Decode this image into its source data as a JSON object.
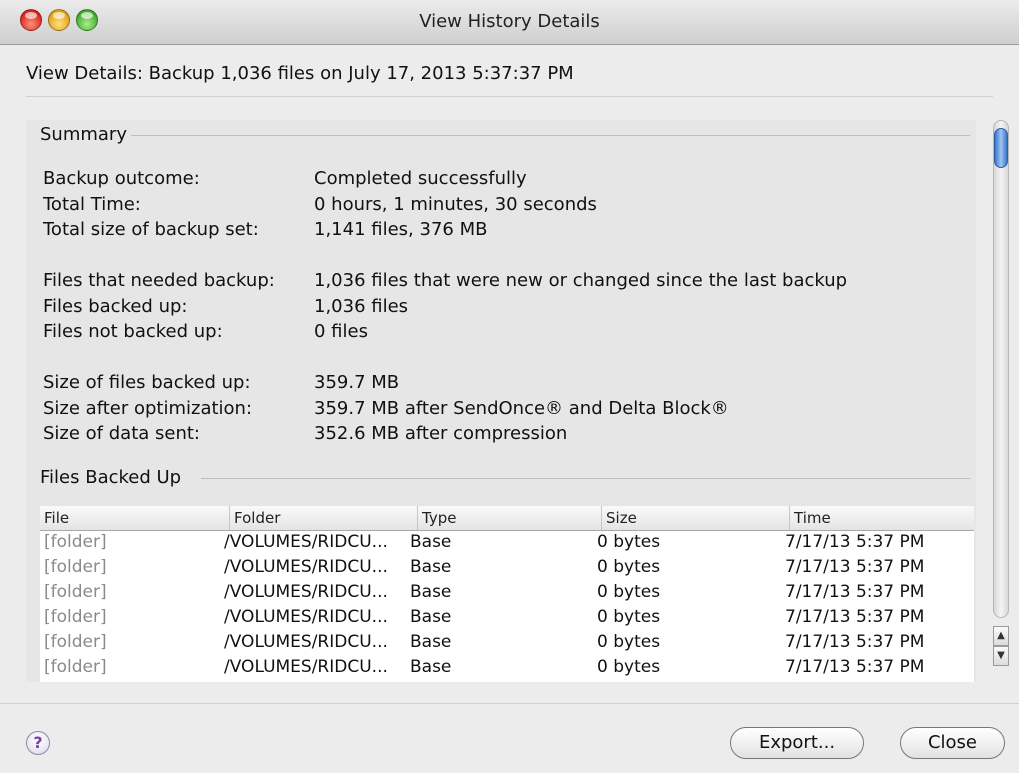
{
  "window": {
    "title": "View History Details"
  },
  "header": {
    "text": "View Details: Backup 1,036 files on July 17, 2013 5:37:37 PM"
  },
  "summary": {
    "label": "Summary",
    "rows": [
      {
        "label": "Backup outcome:",
        "value": "Completed successfully"
      },
      {
        "label": "Total Time:",
        "value": "0 hours, 1 minutes, 30 seconds"
      },
      {
        "label": "Total size of backup set:",
        "value": "1,141 files, 376 MB"
      },
      {
        "label": "Files that needed backup:",
        "value": "1,036 files that were new or changed since the last backup"
      },
      {
        "label": "Files backed up:",
        "value": "1,036 files"
      },
      {
        "label": "Files not backed up:",
        "value": "0 files"
      },
      {
        "label": "Size of files backed up:",
        "value": "359.7 MB"
      },
      {
        "label": "Size after optimization:",
        "value": "359.7 MB after SendOnce® and Delta Block®"
      },
      {
        "label": "Size of data sent:",
        "value": "352.6 MB after compression"
      }
    ]
  },
  "files": {
    "label": "Files Backed Up",
    "columns": [
      "File",
      "Folder",
      "Type",
      "Size",
      "Time"
    ],
    "rows": [
      {
        "file": "[folder]",
        "folder": "/VOLUMES/RIDCU...",
        "type": "Base",
        "size": "0 bytes",
        "time": "7/17/13 5:37 PM"
      },
      {
        "file": "[folder]",
        "folder": "/VOLUMES/RIDCU...",
        "type": "Base",
        "size": "0 bytes",
        "time": "7/17/13 5:37 PM"
      },
      {
        "file": "[folder]",
        "folder": "/VOLUMES/RIDCU...",
        "type": "Base",
        "size": "0 bytes",
        "time": "7/17/13 5:37 PM"
      },
      {
        "file": "[folder]",
        "folder": "/VOLUMES/RIDCU...",
        "type": "Base",
        "size": "0 bytes",
        "time": "7/17/13 5:37 PM"
      },
      {
        "file": "[folder]",
        "folder": "/VOLUMES/RIDCU...",
        "type": "Base",
        "size": "0 bytes",
        "time": "7/17/13 5:37 PM"
      },
      {
        "file": "[folder]",
        "folder": "/VOLUMES/RIDCU...",
        "type": "Base",
        "size": "0 bytes",
        "time": "7/17/13 5:37 PM"
      }
    ]
  },
  "footer": {
    "help": "?",
    "export_label": "Export...",
    "close_label": "Close"
  },
  "icons": {
    "close": "close-traffic-light",
    "minimize": "minimize-traffic-light",
    "zoom": "zoom-traffic-light",
    "help": "help-icon"
  },
  "colors": {
    "accent": "#3a76c9",
    "file_text": "#8a8a8a"
  }
}
